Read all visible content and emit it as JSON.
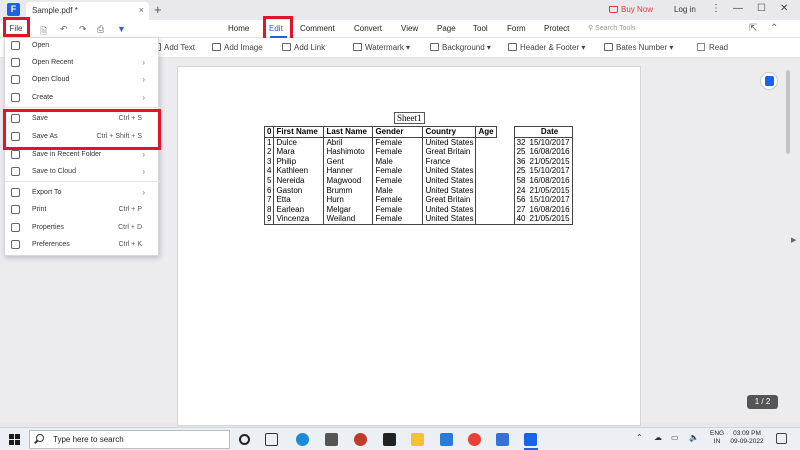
{
  "titlebar": {
    "tab_name": "Sample.pdf *",
    "tab_close": "×",
    "new_tab": "+",
    "buy_now": "Buy Now",
    "login": "Log in",
    "app_logo": "F"
  },
  "menubar": {
    "file": "File",
    "tabs": [
      "Home",
      "Edit",
      "Comment",
      "Convert",
      "View",
      "Page",
      "Tool",
      "Form",
      "Protect"
    ],
    "active_tab": "Edit",
    "search_placeholder": "Search Tools"
  },
  "edit_toolbar": {
    "add_text": "Add Text",
    "add_image": "Add Image",
    "add_link": "Add Link",
    "watermark": "Watermark",
    "background": "Background",
    "header_footer": "Header & Footer",
    "bates_number": "Bates Number",
    "read": "Read"
  },
  "file_menu": {
    "items": [
      {
        "label": "Open",
        "shortcut": "",
        "submenu": false,
        "icon": "folder-icon"
      },
      {
        "label": "Open Recent",
        "shortcut": "",
        "submenu": true,
        "icon": "clock-icon"
      },
      {
        "label": "Open Cloud",
        "shortcut": "",
        "submenu": true,
        "icon": "cloud-icon"
      },
      {
        "label": "Create",
        "shortcut": "",
        "submenu": true,
        "icon": "plus-icon"
      },
      {
        "label": "Save",
        "shortcut": "Ctrl + S",
        "submenu": false,
        "icon": "save-icon"
      },
      {
        "label": "Save As",
        "shortcut": "Ctrl + Shift + S",
        "submenu": false,
        "icon": "save-as-icon"
      },
      {
        "label": "Save in Recent Folder",
        "shortcut": "",
        "submenu": true,
        "icon": "folder-icon"
      },
      {
        "label": "Save to Cloud",
        "shortcut": "",
        "submenu": true,
        "icon": "cloud-icon"
      },
      {
        "label": "Export To",
        "shortcut": "",
        "submenu": true,
        "icon": "export-icon"
      },
      {
        "label": "Print",
        "shortcut": "Ctrl + P",
        "submenu": false,
        "icon": "print-icon"
      },
      {
        "label": "Properties",
        "shortcut": "Ctrl + D",
        "submenu": false,
        "icon": "info-icon"
      },
      {
        "label": "Preferences",
        "shortcut": "Ctrl + K",
        "submenu": false,
        "icon": "settings-icon"
      }
    ]
  },
  "document": {
    "sheet_title": "Sheet1",
    "headers": [
      "0",
      "First Name",
      "Last Name",
      "Gender",
      "Country",
      "Age",
      "",
      "Date"
    ],
    "rows": [
      [
        "1",
        "Dulce",
        "Abril",
        "Female",
        "United States",
        "",
        "32",
        "15/10/2017"
      ],
      [
        "2",
        "Mara",
        "Hashimoto",
        "Female",
        "Great Britain",
        "",
        "25",
        "16/08/2016"
      ],
      [
        "3",
        "Philip",
        "Gent",
        "Male",
        "France",
        "",
        "36",
        "21/05/2015"
      ],
      [
        "4",
        "Kathleen",
        "Hanner",
        "Female",
        "United States",
        "",
        "25",
        "15/10/2017"
      ],
      [
        "5",
        "Nereida",
        "Magwood",
        "Female",
        "United States",
        "",
        "58",
        "16/08/2016"
      ],
      [
        "6",
        "Gaston",
        "Brumm",
        "Male",
        "United States",
        "",
        "24",
        "21/05/2015"
      ],
      [
        "7",
        "Etta",
        "Hurn",
        "Female",
        "Great Britain",
        "",
        "56",
        "15/10/2017"
      ],
      [
        "8",
        "Earlean",
        "Melgar",
        "Female",
        "United States",
        "",
        "27",
        "16/08/2016"
      ],
      [
        "9",
        "Vincenza",
        "Weiland",
        "Female",
        "United States",
        "",
        "40",
        "21/05/2015"
      ]
    ],
    "page_indicator": "1 / 2"
  },
  "taskbar": {
    "search_placeholder": "Type here to search",
    "language": "ENG",
    "region": "IN",
    "time": "03:09 PM",
    "date": "09-09-2022"
  },
  "colors": {
    "accent": "#1a62e6",
    "highlight_box": "#e0152a",
    "buy_now": "#e23d3d"
  }
}
